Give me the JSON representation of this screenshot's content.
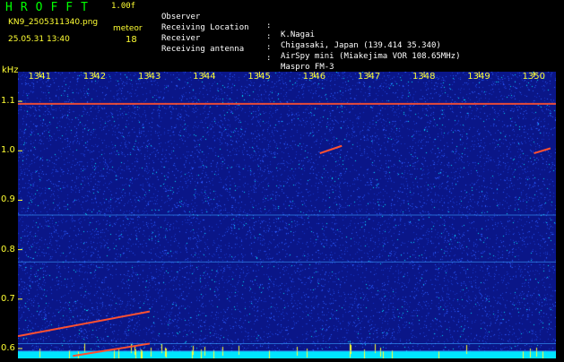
{
  "header": {
    "app_title": "HROFFT",
    "version": "1.00f",
    "filename": "KN9_2505311340.png",
    "meteor_label": "meteor",
    "datetime": "25.05.31 13:40",
    "meteor_count": "18"
  },
  "metadata": [
    {
      "label": "Observer",
      "value": "K.Nagai"
    },
    {
      "label": "Receiving Location",
      "value": "Chigasaki, Japan (139.414 35.340)"
    },
    {
      "label": "Receiver",
      "value": "AirSpy mini (Miakejima VOR 108.65MHz)"
    },
    {
      "label": "Receiving antenna",
      "value": "Maspro FM-3"
    }
  ],
  "separator": ":",
  "chart_data": {
    "type": "heatmap",
    "ylabel": "kHz",
    "x_ticks": [
      "1341",
      "1342",
      "1343",
      "1344",
      "1345",
      "1346",
      "1347",
      "1348",
      "1349",
      "1350"
    ],
    "y_ticks": [
      "1.1",
      "1.0",
      "0.9",
      "0.8",
      "0.7",
      "0.6"
    ],
    "ylim": [
      0.58,
      1.16
    ],
    "xlim": [
      1340.6,
      1350.4
    ],
    "colors": {
      "background": "#0a1688",
      "noise_low": "#2a5cff",
      "noise_high": "#00e5ff",
      "carrier": "#ff5030",
      "ticks": "#ffff33"
    },
    "horizontal_lines": [
      {
        "y": 1.095,
        "strength": "strong"
      },
      {
        "y": 0.87,
        "strength": "weak"
      },
      {
        "y": 0.775,
        "strength": "weak"
      },
      {
        "y": 0.61,
        "strength": "weak"
      },
      {
        "y": 0.595,
        "strength": "weak"
      }
    ],
    "meteor_traces": [
      {
        "x": [
          1340.6,
          1343.0
        ],
        "y": [
          0.625,
          0.675
        ]
      },
      {
        "x": [
          1341.6,
          1343.0
        ],
        "y": [
          0.585,
          0.61
        ]
      },
      {
        "x": [
          1346.1,
          1346.5
        ],
        "y": [
          0.995,
          1.01
        ]
      },
      {
        "x": [
          1350.0,
          1350.3
        ],
        "y": [
          0.995,
          1.005
        ]
      }
    ]
  }
}
